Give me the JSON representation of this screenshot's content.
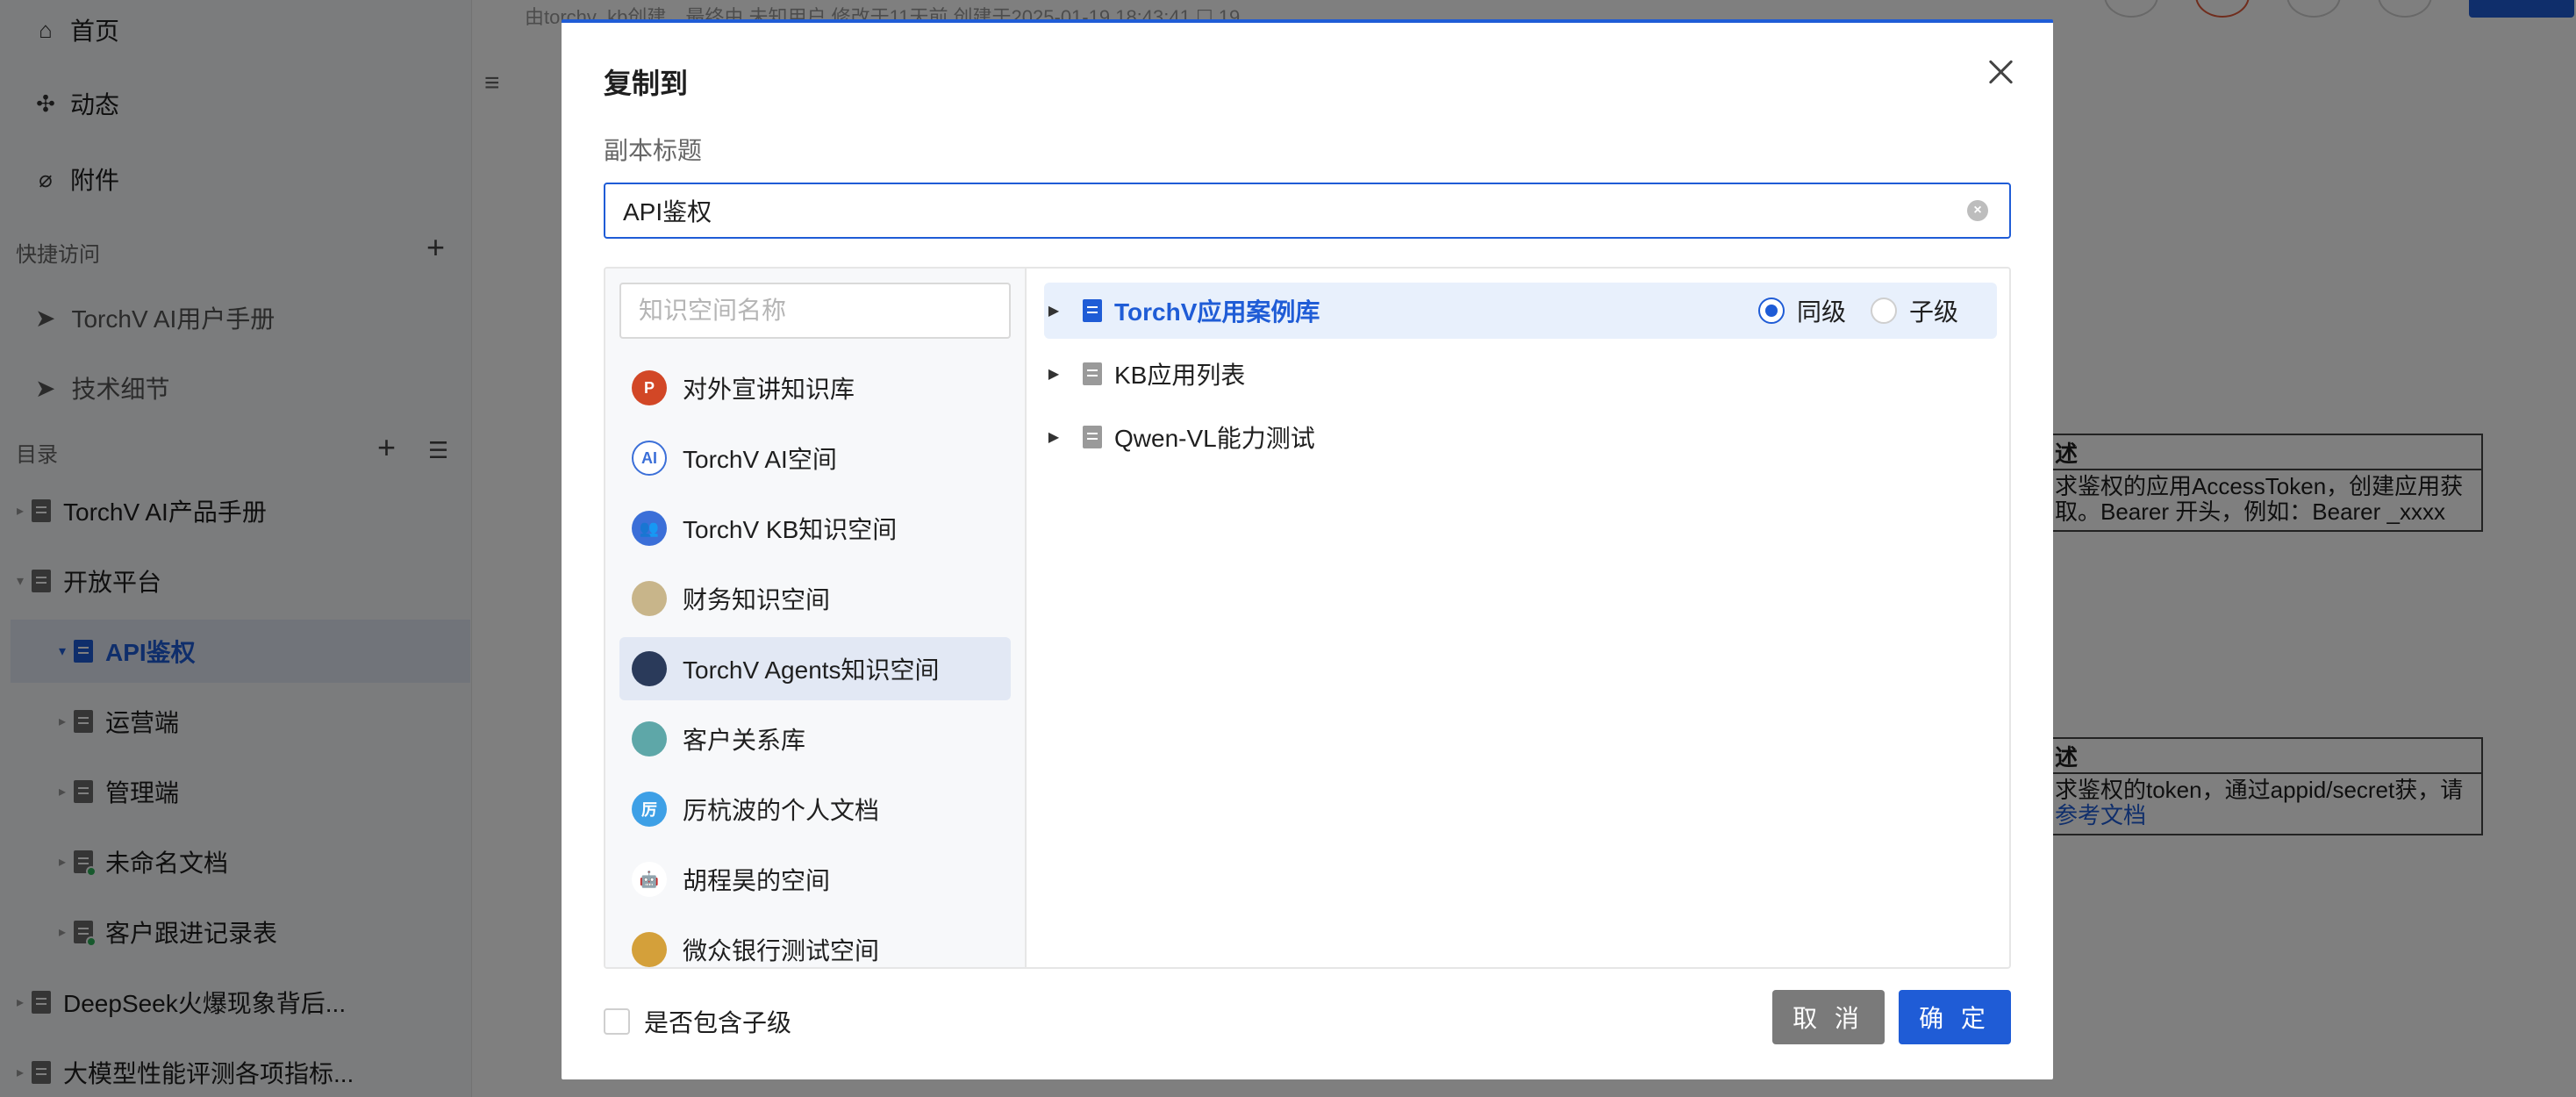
{
  "sidebar": {
    "nav": [
      {
        "label": "首页",
        "icon": "home-icon"
      },
      {
        "label": "动态",
        "icon": "activity-icon"
      },
      {
        "label": "附件",
        "icon": "paperclip-icon"
      }
    ],
    "quick_access_label": "快捷访问",
    "quick_items": [
      {
        "label": "TorchV AI用户手册",
        "icon": "send-icon"
      },
      {
        "label": "技术细节",
        "icon": "send-icon"
      }
    ],
    "toc_label": "目录",
    "tree": [
      {
        "label": "TorchV AI产品手册",
        "caret": "▸"
      },
      {
        "label": "开放平台",
        "caret": "▾"
      },
      {
        "label": "API鉴权",
        "caret": "▾"
      },
      {
        "label": "运营端",
        "caret": "▸"
      },
      {
        "label": "管理端",
        "caret": "▸"
      },
      {
        "label": "未命名文档",
        "caret": "▸"
      },
      {
        "label": "客户跟进记录表",
        "caret": "▸"
      },
      {
        "label": "DeepSeek火爆现象背后...",
        "caret": "▸"
      },
      {
        "label": "大模型性能评测各项指标...",
        "caret": "▸"
      }
    ]
  },
  "page_meta": "由torchv_kb创建，最终由 未知用户 修改于11天前 创建于2025-01-19 18:43:41 ☐ 19",
  "bg_tables": [
    {
      "header": "述",
      "body": "求鉴权的应用AccessToken，创建应用获取。Bearer 开头，例如：Bearer _xxxx"
    },
    {
      "header": "述",
      "body": "求鉴权的token，通过appid/secret获，请",
      "link": "参考文档"
    }
  ],
  "modal": {
    "title": "复制到",
    "copy_title_label": "副本标题",
    "copy_title_value": "API鉴权",
    "space_search_placeholder": "知识空间名称",
    "spaces": [
      {
        "label": "对外宣讲知识库",
        "icon": "powerpoint-icon",
        "icon_text": "P",
        "color": "#d24726"
      },
      {
        "label": "TorchV AI空间",
        "icon": "ai-icon",
        "icon_text": "AI",
        "color": "#ffffff"
      },
      {
        "label": "TorchV KB知识空间",
        "icon": "users-icon",
        "icon_text": "👥",
        "color": "#3b6fd8"
      },
      {
        "label": "财务知识空间",
        "icon": "avatar-image-icon",
        "icon_text": "",
        "color": "#c8b58a"
      },
      {
        "label": "TorchV Agents知识空间",
        "icon": "avatar-image-icon",
        "icon_text": "",
        "color": "#2a3a5a"
      },
      {
        "label": "客户关系库",
        "icon": "avatar-image-icon",
        "icon_text": "",
        "color": "#5ea7a8"
      },
      {
        "label": "厉杭波的个人文档",
        "icon": "avatar-letter-icon",
        "icon_text": "厉",
        "color": "#3ea0e6"
      },
      {
        "label": "胡程昊的空间",
        "icon": "android-icon",
        "icon_text": "🤖",
        "color": "#ffffff"
      },
      {
        "label": "微众银行测试空间",
        "icon": "avatar-image-icon",
        "icon_text": "",
        "color": "#d4a03a"
      }
    ],
    "selected_space_index": 4,
    "nodes": [
      {
        "label": "TorchV应用案例库",
        "selected": true
      },
      {
        "label": "KB应用列表",
        "selected": false
      },
      {
        "label": "Qwen-VL能力测试",
        "selected": false
      }
    ],
    "level_same": "同级",
    "level_child": "子级",
    "include_children_label": "是否包含子级",
    "cancel_label": "取 消",
    "ok_label": "确 定"
  },
  "colors": {
    "accent": "#1f5cd6",
    "overlay": "rgba(0,0,0,0.5)",
    "cancel_button": "#7a7a7a"
  }
}
